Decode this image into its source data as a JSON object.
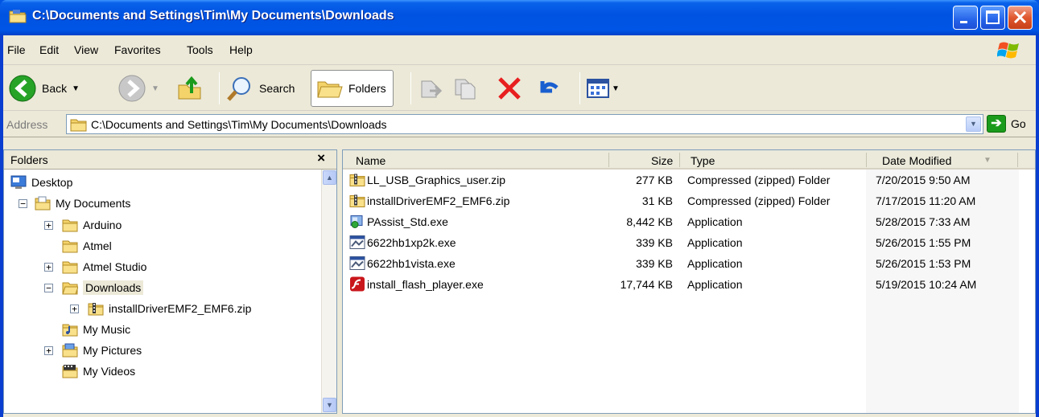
{
  "window": {
    "title": "C:\\Documents and Settings\\Tim\\My Documents\\Downloads",
    "icon": "folder-icon"
  },
  "menu": [
    "File",
    "Edit",
    "View",
    "Favorites",
    "Tools",
    "Help"
  ],
  "toolbar": {
    "back_label": "Back",
    "search_label": "Search",
    "folders_label": "Folders"
  },
  "address": {
    "label": "Address",
    "value": "C:\\Documents and Settings\\Tim\\My Documents\\Downloads",
    "go_label": "Go"
  },
  "folder_pane": {
    "title": "Folders",
    "close": "×",
    "tree": [
      {
        "label": "Desktop",
        "icon": "desktop-icon"
      },
      {
        "label": "My Documents",
        "icon": "my-documents-icon",
        "expander": "−"
      },
      {
        "label": "Arduino",
        "icon": "folder-icon",
        "expander": "+"
      },
      {
        "label": "Atmel",
        "icon": "folder-icon"
      },
      {
        "label": "Atmel Studio",
        "icon": "folder-icon",
        "expander": "+"
      },
      {
        "label": "Downloads",
        "icon": "folder-open-icon",
        "expander": "−",
        "selected": true
      },
      {
        "label": "installDriverEMF2_EMF6.zip",
        "icon": "zip-folder-icon",
        "expander": "+"
      },
      {
        "label": "My Music",
        "icon": "my-music-icon"
      },
      {
        "label": "My Pictures",
        "icon": "my-pictures-icon",
        "expander": "+"
      },
      {
        "label": "My Videos",
        "icon": "my-videos-icon"
      }
    ]
  },
  "file_list": {
    "columns": {
      "name": "Name",
      "size": "Size",
      "type": "Type",
      "date": "Date Modified"
    },
    "rows": [
      {
        "name": "LL_USB_Graphics_user.zip",
        "size": "277 KB",
        "type": "Compressed (zipped) Folder",
        "date": "7/20/2015 9:50 AM",
        "icon": "zip-folder-icon"
      },
      {
        "name": "installDriverEMF2_EMF6.zip",
        "size": "31 KB",
        "type": "Compressed (zipped) Folder",
        "date": "7/17/2015 11:20 AM",
        "icon": "zip-folder-icon"
      },
      {
        "name": "PAssist_Std.exe",
        "size": "8,442 KB",
        "type": "Application",
        "date": "5/28/2015 7:33 AM",
        "icon": "installer-icon"
      },
      {
        "name": "6622hb1xp2k.exe",
        "size": "339 KB",
        "type": "Application",
        "date": "5/26/2015 1:55 PM",
        "icon": "exe-icon"
      },
      {
        "name": "6622hb1vista.exe",
        "size": "339 KB",
        "type": "Application",
        "date": "5/26/2015 1:53 PM",
        "icon": "exe-icon"
      },
      {
        "name": "install_flash_player.exe",
        "size": "17,744 KB",
        "type": "Application",
        "date": "5/19/2015 10:24 AM",
        "icon": "flash-icon"
      }
    ]
  },
  "colors": {
    "titlebar": "#0054e3",
    "chrome": "#ece9d8",
    "close_button": "#e0582e",
    "delete_red": "#e81f1f",
    "go_green": "#1b9b1b"
  }
}
